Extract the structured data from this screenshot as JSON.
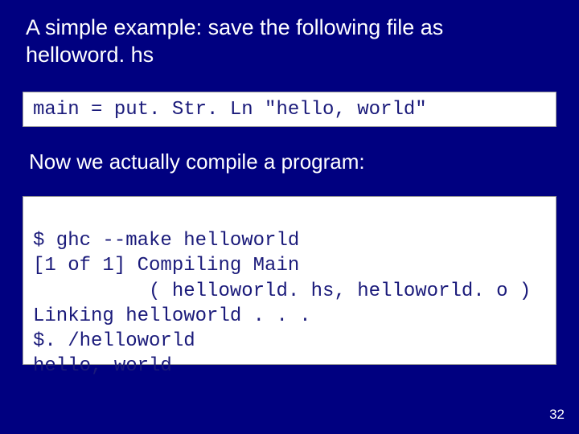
{
  "heading": "A simple example: save the following file as helloword. hs",
  "code1": "main = put. Str. Ln \"hello, world\"",
  "subtext": "Now we actually compile a program:",
  "code2_line1": "$ ghc --make helloworld",
  "code2_line2": "[1 of 1] Compiling Main",
  "code2_line3": "          ( helloworld. hs, helloworld. o )",
  "code2_line4": "Linking helloworld . . .",
  "code2_line5": "$. /helloworld",
  "code2_line6": "hello, world",
  "page_number": "32"
}
